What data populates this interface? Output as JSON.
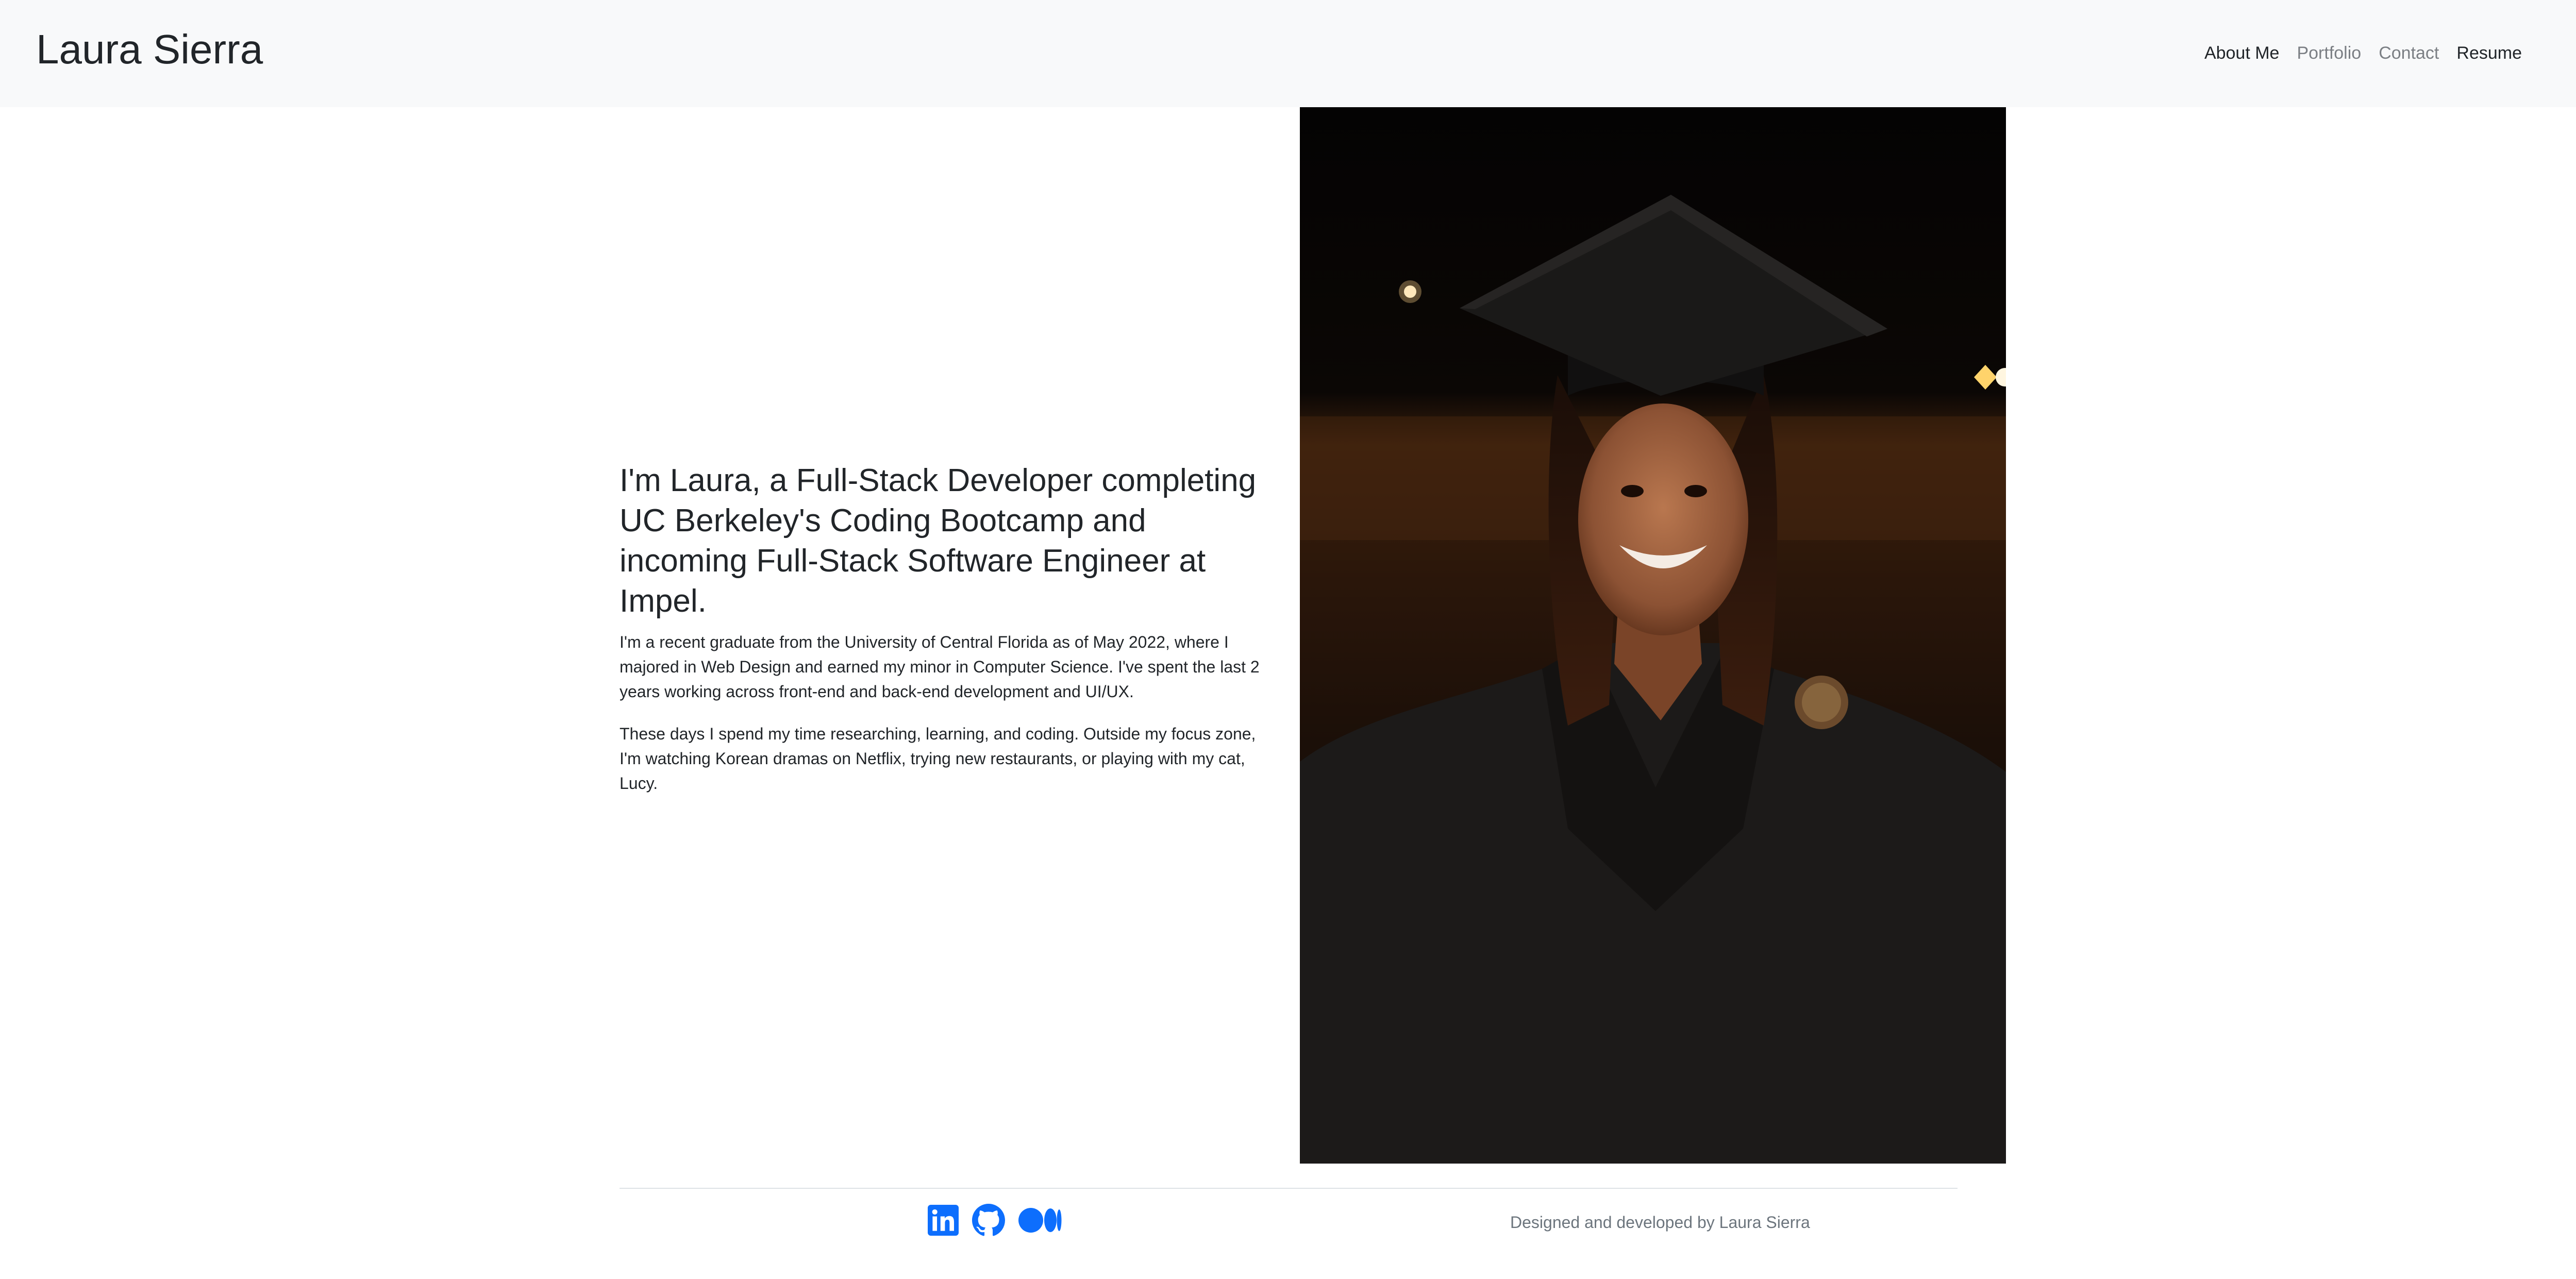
{
  "navbar": {
    "brand": "Laura Sierra",
    "links": [
      {
        "label": "About Me",
        "state": "active"
      },
      {
        "label": "Portfolio",
        "state": "muted"
      },
      {
        "label": "Contact",
        "state": "muted"
      },
      {
        "label": "Resume",
        "state": "active"
      }
    ]
  },
  "about": {
    "headline": "I'm Laura, a Full-Stack Developer completing UC Berkeley's Coding Bootcamp and incoming Full-Stack Software Engineer at Impel.",
    "paragraphs": [
      "I'm a recent graduate from the University of Central Florida as of May 2022, where I majored in Web Design and earned my minor in Computer Science. I've spent the last 2 years working across front-end and back-end development and UI/UX.",
      "These days I spend my time researching, learning, and coding. Outside my focus zone, I'm watching Korean dramas on Netflix, trying new restaurants, or playing with my cat, Lucy."
    ]
  },
  "photo": {
    "subject": "graduation-portrait"
  },
  "footer": {
    "social_icons": [
      "linkedin-icon",
      "github-icon",
      "medium-icon"
    ],
    "credit": "Designed and developed by Laura Sierra"
  },
  "colors": {
    "navbar_bg": "#f8f9fa",
    "text": "#212529",
    "muted": "#6c757d",
    "icon_blue": "#0d6efd"
  }
}
